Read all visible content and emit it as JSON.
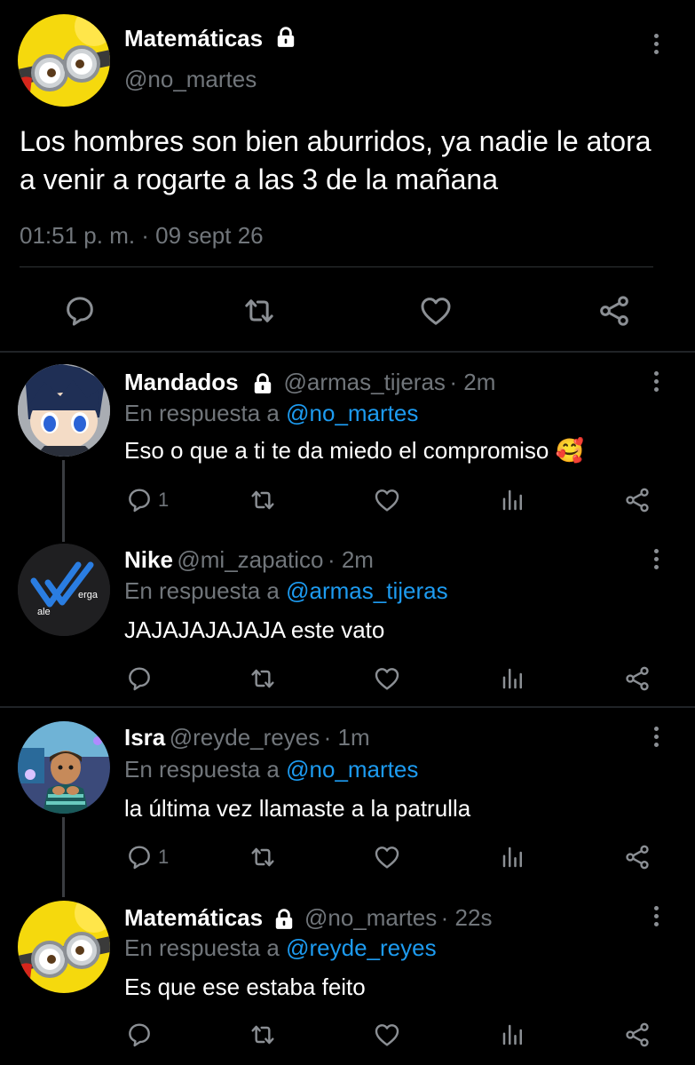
{
  "main_tweet": {
    "name": "Matemáticas",
    "handle": "@no_martes",
    "text": "Los hombres son bien aburridos, ya nadie le atora a venir a rogarte a las 3 de la mañana",
    "timestamp": "01:51 p. m. · 09 sept 26",
    "actions": [
      "reply-icon",
      "retweet-icon",
      "like-icon",
      "share-icon"
    ]
  },
  "replies": [
    {
      "name": "Mandados",
      "handle": "@armas_tijeras",
      "time": "· 2m",
      "reply_prefix": "En respuesta a",
      "reply_to": "@no_martes",
      "text": "Eso o que a ti te da miedo el compromiso",
      "emoji": "🥰",
      "reply_count": "1"
    },
    {
      "name": "Nike",
      "handle": "@mi_zapatico",
      "time": "· 2m",
      "reply_prefix": "En respuesta a",
      "reply_to": "@armas_tijeras",
      "text": "JAJAJAJAJAJA este vato",
      "avatar_text_1": "ale",
      "avatar_text_2": "erga"
    },
    {
      "name": "Isra",
      "handle": "@reyde_reyes",
      "time": "· 1m",
      "reply_prefix": "En respuesta a",
      "reply_to": "@no_martes",
      "text": "la última vez llamaste a la patrulla",
      "reply_count": "1"
    },
    {
      "name": "Matemáticas",
      "handle": "@no_martes",
      "time": "· 22s",
      "reply_prefix": "En respuesta a",
      "reply_to": "@reyde_reyes",
      "text": "Es que ese estaba feito"
    }
  ],
  "colors": {
    "mention": "#1d9bf0",
    "muted": "#71767b",
    "background": "#000000"
  }
}
